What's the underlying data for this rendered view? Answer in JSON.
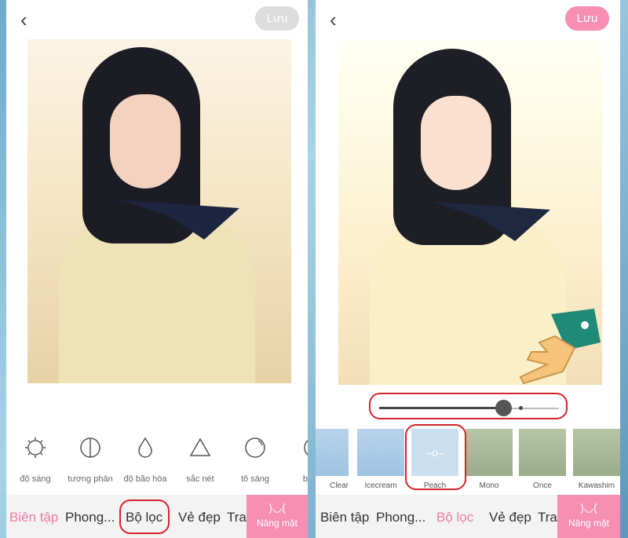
{
  "left": {
    "back_icon": "chevron-left-icon",
    "save_label": "Lưu",
    "save_color": "#dddddd",
    "tools": [
      {
        "icon": "brightness-icon",
        "label": "độ sáng"
      },
      {
        "icon": "contrast-icon",
        "label": "tương phản"
      },
      {
        "icon": "saturation-drop-icon",
        "label": "độ bão hòa"
      },
      {
        "icon": "sharpness-triangle-icon",
        "label": "sắc nét"
      },
      {
        "icon": "highlight-circle-icon",
        "label": "tô sáng"
      },
      {
        "icon": "shadow-icon",
        "label": "bón"
      }
    ],
    "nav": [
      "Biên tập",
      "Phong...",
      "Bộ lọc",
      "Vẻ đẹp",
      "Tra"
    ],
    "nav_active": "Biên tập",
    "face_lift": "Nâng mặt"
  },
  "right": {
    "back_icon": "chevron-left-icon",
    "save_label": "Lưu",
    "save_color": "#f78fb3",
    "filter_intensity": 0.69,
    "filters": [
      "Clear",
      "Icecream",
      "Peach",
      "Mono",
      "Once",
      "Kawashim"
    ],
    "selected_filter": "Peach",
    "nav": [
      "Biên tập",
      "Phong...",
      "Bộ lọc",
      "Vẻ đẹp",
      "Tra"
    ],
    "nav_active": "Bộ lọc",
    "face_lift": "Nâng mặt"
  },
  "colors": {
    "accent": "#f78fb3",
    "active_text": "#f07aa3",
    "highlight": "#d6242c"
  }
}
